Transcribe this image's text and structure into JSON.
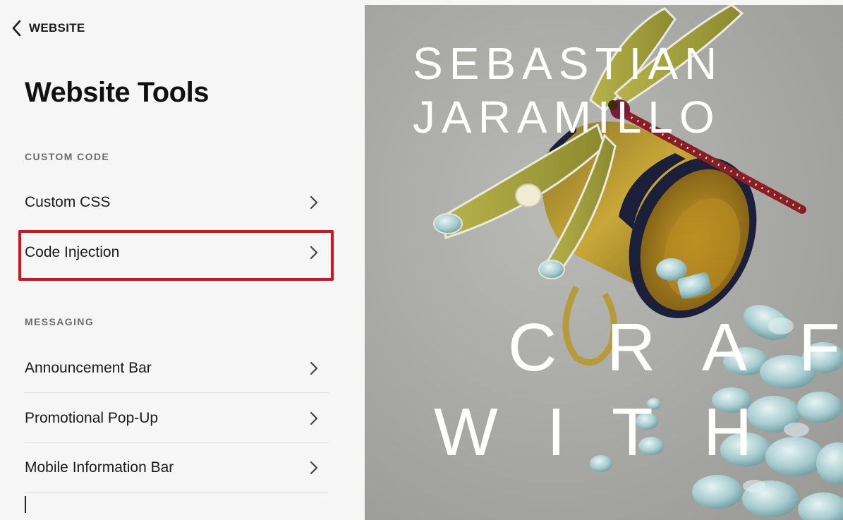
{
  "nav": {
    "back_label": "WEBSITE"
  },
  "page": {
    "title": "Website Tools"
  },
  "sections": {
    "custom_code": {
      "label": "CUSTOM CODE",
      "items": [
        {
          "label": "Custom CSS"
        },
        {
          "label": "Code Injection",
          "highlighted": true
        }
      ]
    },
    "messaging": {
      "label": "MESSAGING",
      "items": [
        {
          "label": "Announcement Bar"
        },
        {
          "label": "Promotional Pop-Up"
        },
        {
          "label": "Mobile Information Bar"
        }
      ]
    }
  },
  "preview": {
    "brand_line_1": "SEBASTIAN",
    "brand_line_2": "JARAMILLO",
    "hero_line_1": [
      "C",
      "R",
      "A",
      "F"
    ],
    "hero_line_2": [
      "W",
      "I",
      "T",
      "H"
    ]
  },
  "icons": {
    "back": "chevron-left-icon",
    "row_arrow": "chevron-right-icon"
  },
  "colors": {
    "highlight": "#d6121c",
    "sidebar_bg": "#f6f6f6",
    "preview_bg": "#a9a9a6"
  }
}
